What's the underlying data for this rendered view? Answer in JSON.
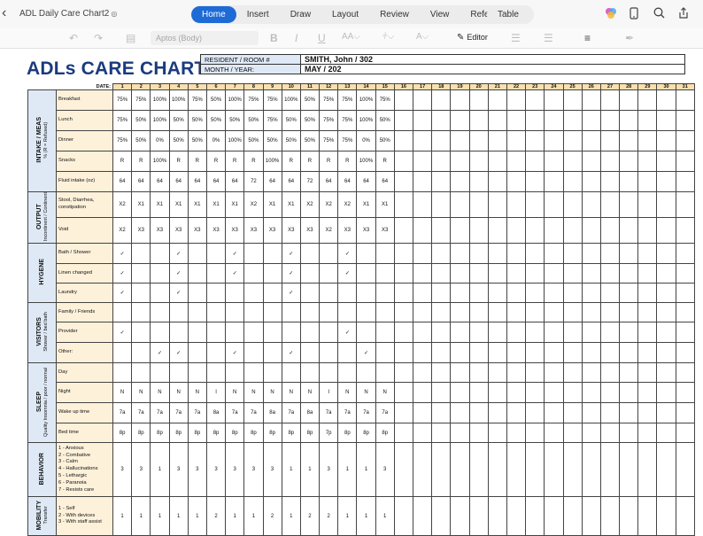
{
  "app": {
    "doc_title": "ADL Daily Care Chart2",
    "tabs": [
      "Home",
      "Insert",
      "Draw",
      "Layout",
      "Review",
      "View",
      "References"
    ],
    "active_tab": "Home",
    "context_tab": "Table"
  },
  "toolbar": {
    "font_name": "Aptos (Body)",
    "editor_label": "Editor"
  },
  "sheet": {
    "title": "ADLs CARE CHART",
    "header": [
      {
        "label": "RESIDENT / ROOM #",
        "value": "SMITH, John / 302"
      },
      {
        "label": "MONTH / YEAR:",
        "value": "MAY / 202"
      }
    ],
    "date_label": "DATE:",
    "days": [
      "1",
      "2",
      "3",
      "4",
      "5",
      "6",
      "7",
      "8",
      "9",
      "10",
      "11",
      "12",
      "13",
      "14",
      "15",
      "16",
      "17",
      "18",
      "19",
      "20",
      "21",
      "22",
      "23",
      "24",
      "25",
      "26",
      "27",
      "28",
      "29",
      "30",
      "31"
    ],
    "sections": [
      {
        "name": "INTAKE / MEAS",
        "sub": "% (R = Refused)",
        "rows": [
          {
            "label": "Breakfast",
            "values": [
              "75%",
              "75%",
              "100%",
              "100%",
              "75%",
              "50%",
              "100%",
              "75%",
              "75%",
              "100%",
              "50%",
              "75%",
              "75%",
              "100%",
              "75%"
            ]
          },
          {
            "label": "Lunch",
            "values": [
              "75%",
              "50%",
              "100%",
              "50%",
              "50%",
              "50%",
              "50%",
              "50%",
              "75%",
              "50%",
              "50%",
              "75%",
              "75%",
              "100%",
              "50%"
            ]
          },
          {
            "label": "Dinner",
            "values": [
              "75%",
              "50%",
              "0%",
              "50%",
              "50%",
              "0%",
              "100%",
              "50%",
              "50%",
              "50%",
              "50%",
              "75%",
              "75%",
              "0%",
              "50%"
            ]
          },
          {
            "label": "Snacks",
            "values": [
              "R",
              "R",
              "100%",
              "R",
              "R",
              "R",
              "R",
              "R",
              "100%",
              "R",
              "R",
              "R",
              "R",
              "100%",
              "R"
            ]
          },
          {
            "label": "Fluid intake (oz)",
            "values": [
              "64",
              "64",
              "64",
              "64",
              "64",
              "64",
              "64",
              "72",
              "64",
              "64",
              "72",
              "64",
              "64",
              "64",
              "64"
            ]
          }
        ]
      },
      {
        "name": "OUTPUT",
        "sub": "Incontinent / Continent",
        "rows": [
          {
            "label": "Stool, Diarrhea, constipation",
            "values": [
              "X2",
              "X1",
              "X1",
              "X1",
              "X1",
              "X1",
              "X1",
              "X2",
              "X1",
              "X1",
              "X2",
              "X2",
              "X2",
              "X1",
              "X1"
            ]
          },
          {
            "label": "Void",
            "values": [
              "X2",
              "X3",
              "X3",
              "X3",
              "X3",
              "X3",
              "X3",
              "X3",
              "X3",
              "X3",
              "X3",
              "X2",
              "X3",
              "X3",
              "X3"
            ]
          }
        ]
      },
      {
        "name": "HYGENE",
        "sub": "",
        "rows": [
          {
            "label": "Bath / Shower",
            "values": [
              "✓",
              "",
              "",
              "✓",
              "",
              "",
              "✓",
              "",
              "",
              "✓",
              "",
              "",
              "✓",
              "",
              ""
            ]
          },
          {
            "label": "Linen changed",
            "values": [
              "✓",
              "",
              "",
              "✓",
              "",
              "",
              "✓",
              "",
              "",
              "✓",
              "",
              "",
              "✓",
              "",
              ""
            ]
          },
          {
            "label": "Laundry",
            "values": [
              "✓",
              "",
              "",
              "✓",
              "",
              "",
              "",
              "",
              "",
              "✓",
              "",
              "",
              "",
              "",
              ""
            ]
          }
        ]
      },
      {
        "name": "VISITORS",
        "sub": "Shower / bed bath",
        "rows": [
          {
            "label": "Family / Friends",
            "values": [
              "",
              "",
              "",
              "",
              "",
              "",
              "",
              "",
              "",
              "",
              "",
              "",
              "",
              "",
              ""
            ]
          },
          {
            "label": "Provider",
            "values": [
              "✓",
              "",
              "",
              "",
              "",
              "",
              "",
              "",
              "",
              "",
              "",
              "",
              "✓",
              "",
              ""
            ]
          },
          {
            "label": "Other:",
            "values": [
              "",
              "",
              "✓",
              "✓",
              "",
              "",
              "✓",
              "",
              "",
              "✓",
              "",
              "",
              "",
              "✓",
              ""
            ]
          }
        ]
      },
      {
        "name": "SLEEP",
        "sub": "Quality Insomnia / poor / normal",
        "rows": [
          {
            "label": "Day",
            "values": [
              "",
              "",
              "",
              "",
              "",
              "",
              "",
              "",
              "",
              "",
              "",
              "",
              "",
              "",
              ""
            ]
          },
          {
            "label": "Night",
            "values": [
              "N",
              "N",
              "N",
              "N",
              "N",
              "I",
              "N",
              "N",
              "N",
              "N",
              "N",
              "I",
              "N",
              "N",
              "N"
            ]
          },
          {
            "label": "Wake up time",
            "values": [
              "7a",
              "7a",
              "7a",
              "7a",
              "7a",
              "8a",
              "7a",
              "7a",
              "8a",
              "7a",
              "8a",
              "7a",
              "7a",
              "7a",
              "7a"
            ]
          },
          {
            "label": "Bed time",
            "values": [
              "8p",
              "8p",
              "8p",
              "8p",
              "8p",
              "8p",
              "8p",
              "8p",
              "8p",
              "8p",
              "8p",
              "7p",
              "8p",
              "8p",
              "8p"
            ]
          }
        ]
      },
      {
        "name": "BEHAVIOR",
        "sub": "",
        "rows": [
          {
            "label": "1 - Anxious\n2 - Combative\n3 - Calm\n4 - Hallucinations\n5 - Lethargic\n6 - Paranoia\n7 - Resists care",
            "values": [
              "3",
              "3",
              "1",
              "3",
              "3",
              "3",
              "3",
              "3",
              "3",
              "1",
              "1",
              "3",
              "1",
              "1",
              "3"
            ]
          }
        ]
      },
      {
        "name": "MOBILITY",
        "sub": "Transfer",
        "rows": [
          {
            "label": "1 - Self\n2 - With devices\n3 - With staff assist",
            "values": [
              "1",
              "1",
              "1",
              "1",
              "1",
              "2",
              "1",
              "1",
              "2",
              "1",
              "2",
              "2",
              "1",
              "1",
              "1"
            ]
          }
        ]
      }
    ]
  }
}
